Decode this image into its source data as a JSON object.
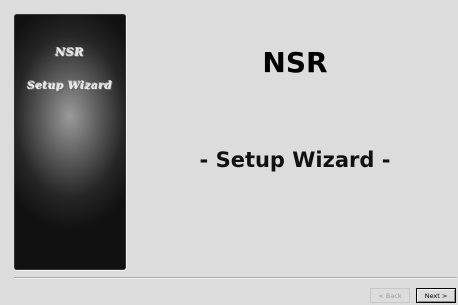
{
  "banner": {
    "line1": "NSR",
    "line2": "Setup Wizard"
  },
  "main": {
    "title": "NSR",
    "subtitle": "- Setup Wizard -"
  },
  "buttons": {
    "back_label": "< Back",
    "back_enabled": false,
    "next_label": "Next >",
    "next_enabled": true
  },
  "colors": {
    "background": "#dcdcdc",
    "banner_dark": "#111111",
    "banner_light": "#9a9a9a",
    "disabled_text": "#9a9a9a"
  }
}
